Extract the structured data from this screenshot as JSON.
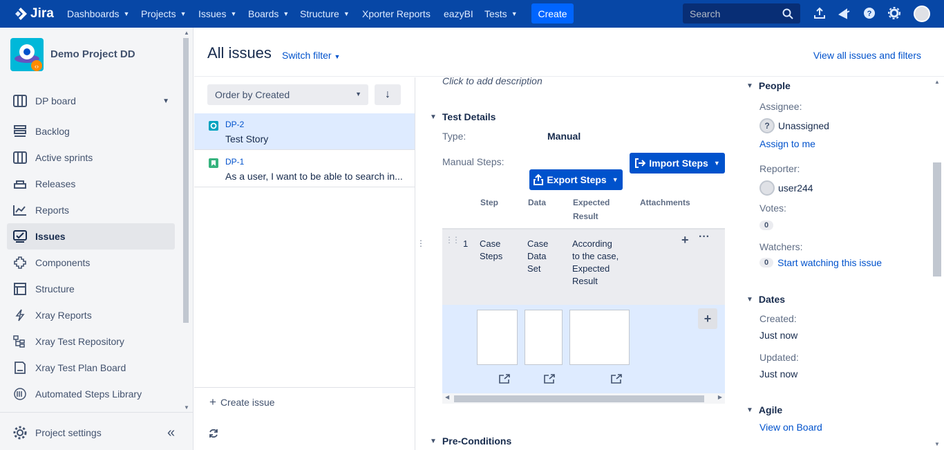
{
  "topnav": {
    "logo": "Jira",
    "items": [
      {
        "label": "Dashboards",
        "has_menu": true
      },
      {
        "label": "Projects",
        "has_menu": true
      },
      {
        "label": "Issues",
        "has_menu": true
      },
      {
        "label": "Boards",
        "has_menu": true
      },
      {
        "label": "Structure",
        "has_menu": true
      },
      {
        "label": "Xporter Reports",
        "has_menu": false
      },
      {
        "label": "eazyBI",
        "has_menu": false
      },
      {
        "label": "Tests",
        "has_menu": true
      }
    ],
    "create": "Create",
    "search_placeholder": "Search"
  },
  "sidebar": {
    "project_name": "Demo Project DD",
    "board": "DP board",
    "items": [
      {
        "label": "Backlog",
        "icon": "backlog-icon"
      },
      {
        "label": "Active sprints",
        "icon": "sprints-icon"
      },
      {
        "label": "Releases",
        "icon": "releases-icon"
      },
      {
        "label": "Reports",
        "icon": "reports-icon"
      },
      {
        "label": "Issues",
        "icon": "issues-icon",
        "active": true
      },
      {
        "label": "Components",
        "icon": "components-icon"
      },
      {
        "label": "Structure",
        "icon": "structure-icon"
      },
      {
        "label": "Xray Reports",
        "icon": "xray-reports-icon"
      },
      {
        "label": "Xray Test Repository",
        "icon": "repository-icon"
      },
      {
        "label": "Xray Test Plan Board",
        "icon": "plan-board-icon"
      },
      {
        "label": "Automated Steps Library",
        "icon": "library-icon"
      }
    ],
    "settings": "Project settings"
  },
  "header": {
    "title": "All issues",
    "switch_filter": "Switch filter",
    "view_all": "View all issues and filters"
  },
  "issue_list": {
    "order_by": "Order by Created",
    "issues": [
      {
        "key": "DP-2",
        "summary": "Test Story",
        "type_color": "#00a3bf",
        "selected": true
      },
      {
        "key": "DP-1",
        "summary": "As a user, I want to be able to search in...",
        "type_color": "#36b37e",
        "selected": false
      }
    ],
    "create_issue": "Create issue"
  },
  "detail": {
    "description_placeholder": "Click to add description",
    "test_details": "Test Details",
    "type_label": "Type:",
    "type_value": "Manual",
    "manual_steps_label": "Manual Steps:",
    "import_steps": "Import Steps",
    "export_steps": "Export Steps",
    "columns": [
      "Step",
      "Data",
      "Expected Result",
      "Attachments"
    ],
    "step": {
      "index": "1",
      "step": "Case Steps",
      "data": "Case Data Set",
      "expected": "According to the case, Expected Result"
    },
    "pre_conditions": "Pre-Conditions"
  },
  "people": {
    "title": "People",
    "assignee_label": "Assignee:",
    "assignee": "Unassigned",
    "assign_to_me": "Assign to me",
    "reporter_label": "Reporter:",
    "reporter": "user244",
    "votes_label": "Votes:",
    "votes": "0",
    "watchers_label": "Watchers:",
    "watchers": "0",
    "start_watching": "Start watching this issue"
  },
  "dates": {
    "title": "Dates",
    "created_label": "Created:",
    "created": "Just now",
    "updated_label": "Updated:",
    "updated": "Just now"
  },
  "agile": {
    "title": "Agile",
    "view_on_board": "View on Board"
  }
}
